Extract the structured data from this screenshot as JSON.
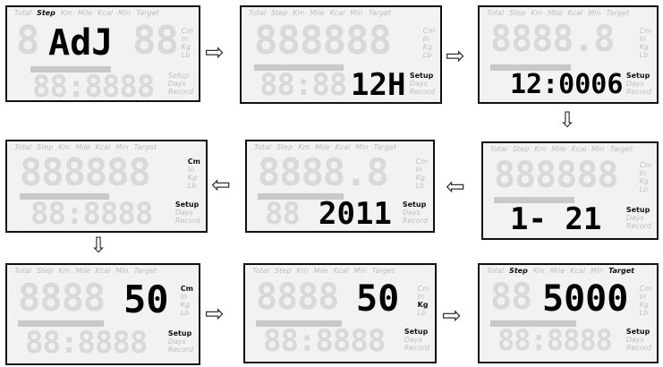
{
  "header_labels": [
    "Total",
    "Step",
    "Km",
    "Mile",
    "Kcal",
    "Min",
    "Target"
  ],
  "side_upper": [
    "Cm",
    "In",
    "Kg",
    "Lb"
  ],
  "side_lower": [
    "Setup",
    "Days",
    "Record"
  ],
  "panels": [
    {
      "id": "p1",
      "main": "AdJ",
      "lower": "",
      "active_header": [
        "Step"
      ],
      "active_side": []
    },
    {
      "id": "p2",
      "main": "",
      "lower": "12H",
      "active_header": [],
      "active_side": [
        "Setup"
      ]
    },
    {
      "id": "p3",
      "main": "",
      "lower": "12:0006",
      "active_header": [],
      "active_side": [
        "Setup"
      ]
    },
    {
      "id": "p4",
      "main": "",
      "lower": "1- 21",
      "active_header": [],
      "active_side": [
        "Setup"
      ]
    },
    {
      "id": "p5",
      "main": "",
      "lower": "2011",
      "active_header": [],
      "active_side": [
        "Setup"
      ]
    },
    {
      "id": "p6",
      "main": "",
      "lower": "",
      "active_header": [],
      "active_side": [
        "Cm",
        "Setup"
      ]
    },
    {
      "id": "p7",
      "main": "50",
      "lower": "",
      "active_header": [],
      "active_side": [
        "Cm",
        "Setup"
      ]
    },
    {
      "id": "p8",
      "main": "50",
      "lower": "",
      "active_header": [],
      "active_side": [
        "Kg",
        "Setup"
      ]
    },
    {
      "id": "p9",
      "main": "5000",
      "lower": "",
      "active_header": [
        "Step",
        "Target"
      ],
      "active_side": [
        "Setup"
      ]
    }
  ],
  "arrow_glyph_right": "⇨",
  "arrow_glyph_left": "⇦",
  "arrow_glyph_down": "⇩"
}
